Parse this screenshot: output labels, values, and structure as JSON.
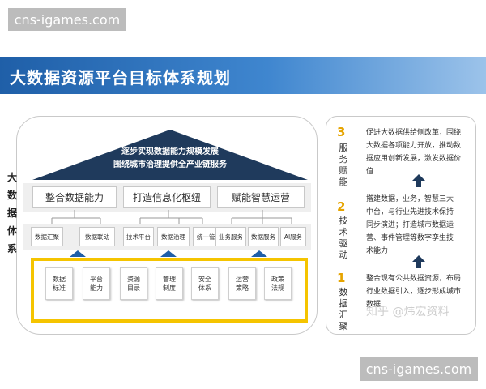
{
  "watermarks": {
    "top": "cns-igames.com",
    "bottom": "cns-igames.com",
    "zhihu": "知乎 @炜宏资料"
  },
  "header": {
    "title": "大数据资源平台目标体系规划"
  },
  "left_panel": {
    "side_label": [
      "大",
      "数",
      "据",
      "体",
      "系"
    ],
    "roof_lines": [
      "逐步实现数据能力规模发展",
      "围绕城市治理提供全产业链服务"
    ],
    "mid_boxes": [
      "整合数据能力",
      "打造信息化枢纽",
      "赋能智慧运营"
    ],
    "sub_boxes": [
      "数据汇聚",
      "数据联动",
      "技术平台",
      "数据治理",
      "统一管控",
      "业务服务",
      "数据服务",
      "AI服务"
    ],
    "foundations": [
      [
        "数据",
        "标准"
      ],
      [
        "平台",
        "能力"
      ],
      [
        "资源",
        "目录"
      ],
      [
        "管理",
        "制度"
      ],
      [
        "安全",
        "体系"
      ],
      [
        "运营",
        "策略"
      ],
      [
        "政策",
        "法规"
      ]
    ]
  },
  "right_panel": {
    "steps": [
      {
        "num": "3",
        "label": [
          "服",
          "务",
          "赋",
          "能"
        ],
        "desc": [
          "促进大数据供给侧改革，围绕",
          "大数据各项能力开放，推动数",
          "据应用创新发展，激发数据价",
          "值"
        ]
      },
      {
        "num": "2",
        "label": [
          "技",
          "术",
          "驱",
          "动"
        ],
        "desc": [
          "搭建数据，业务，智慧三大",
          "中台，与行业先进技术保持",
          "同步演进；打造城市数据运",
          "营、事件管理等数字孪生技",
          "术能力"
        ]
      },
      {
        "num": "1",
        "label": [
          "数",
          "据",
          "汇",
          "聚"
        ],
        "desc": [
          "整合现有公共数据资源，布局",
          "行业数据引入，逐步形成城市",
          "数据"
        ]
      }
    ]
  },
  "colors": {
    "banner": "#2a6fbe",
    "roof": "#1f3a5c",
    "accent": "#f5c400",
    "arrow_up": "#1f3a5c",
    "step_num": "#e6a400"
  }
}
